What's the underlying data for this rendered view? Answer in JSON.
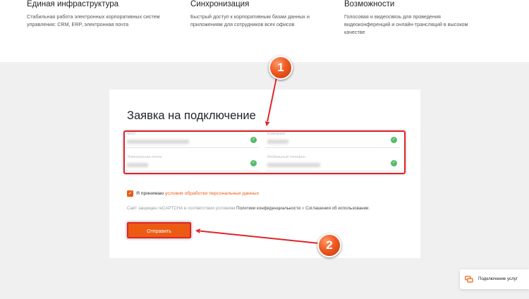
{
  "features": [
    {
      "title": "Единая инфраструктура",
      "description": "Стабильная работа электронных корпоративных систем управления: CRM, ERP, электронная почта"
    },
    {
      "title": "Синхронизация",
      "description": "Быстрый доступ к корпоративным базам данных и приложениям для сотрудников всех офисов"
    },
    {
      "title": "Возможности",
      "description": "Голосовая и видеосвязь для проведения видеоконференций и онлайн-трансляций в высоком качестве"
    }
  ],
  "form": {
    "title": "Заявка на подключение",
    "fields": [
      {
        "label": "ФИО"
      },
      {
        "label": "Компания"
      },
      {
        "label": "Электронная почта"
      },
      {
        "label": "Мобильный телефон"
      }
    ],
    "consent_prefix": "Я принимаю",
    "consent_link": "условия обработки персональных данных",
    "recaptcha_prefix": "Сайт защищен reCAPTCHA в соответствии условиям",
    "recaptcha_privacy": "Политики конфиденциальности",
    "recaptcha_and": "и",
    "recaptcha_terms": "Соглашения об использовании",
    "submit_label": "Отправить"
  },
  "annotations": {
    "badge1": "1",
    "badge2": "2"
  },
  "service_button": {
    "label": "Подключение услуг"
  },
  "colors": {
    "accent": "#ec5b13",
    "highlight": "#e0252b",
    "success": "#55bb6a"
  },
  "icons": {
    "check": "check-icon",
    "chat": "chat-icon"
  }
}
